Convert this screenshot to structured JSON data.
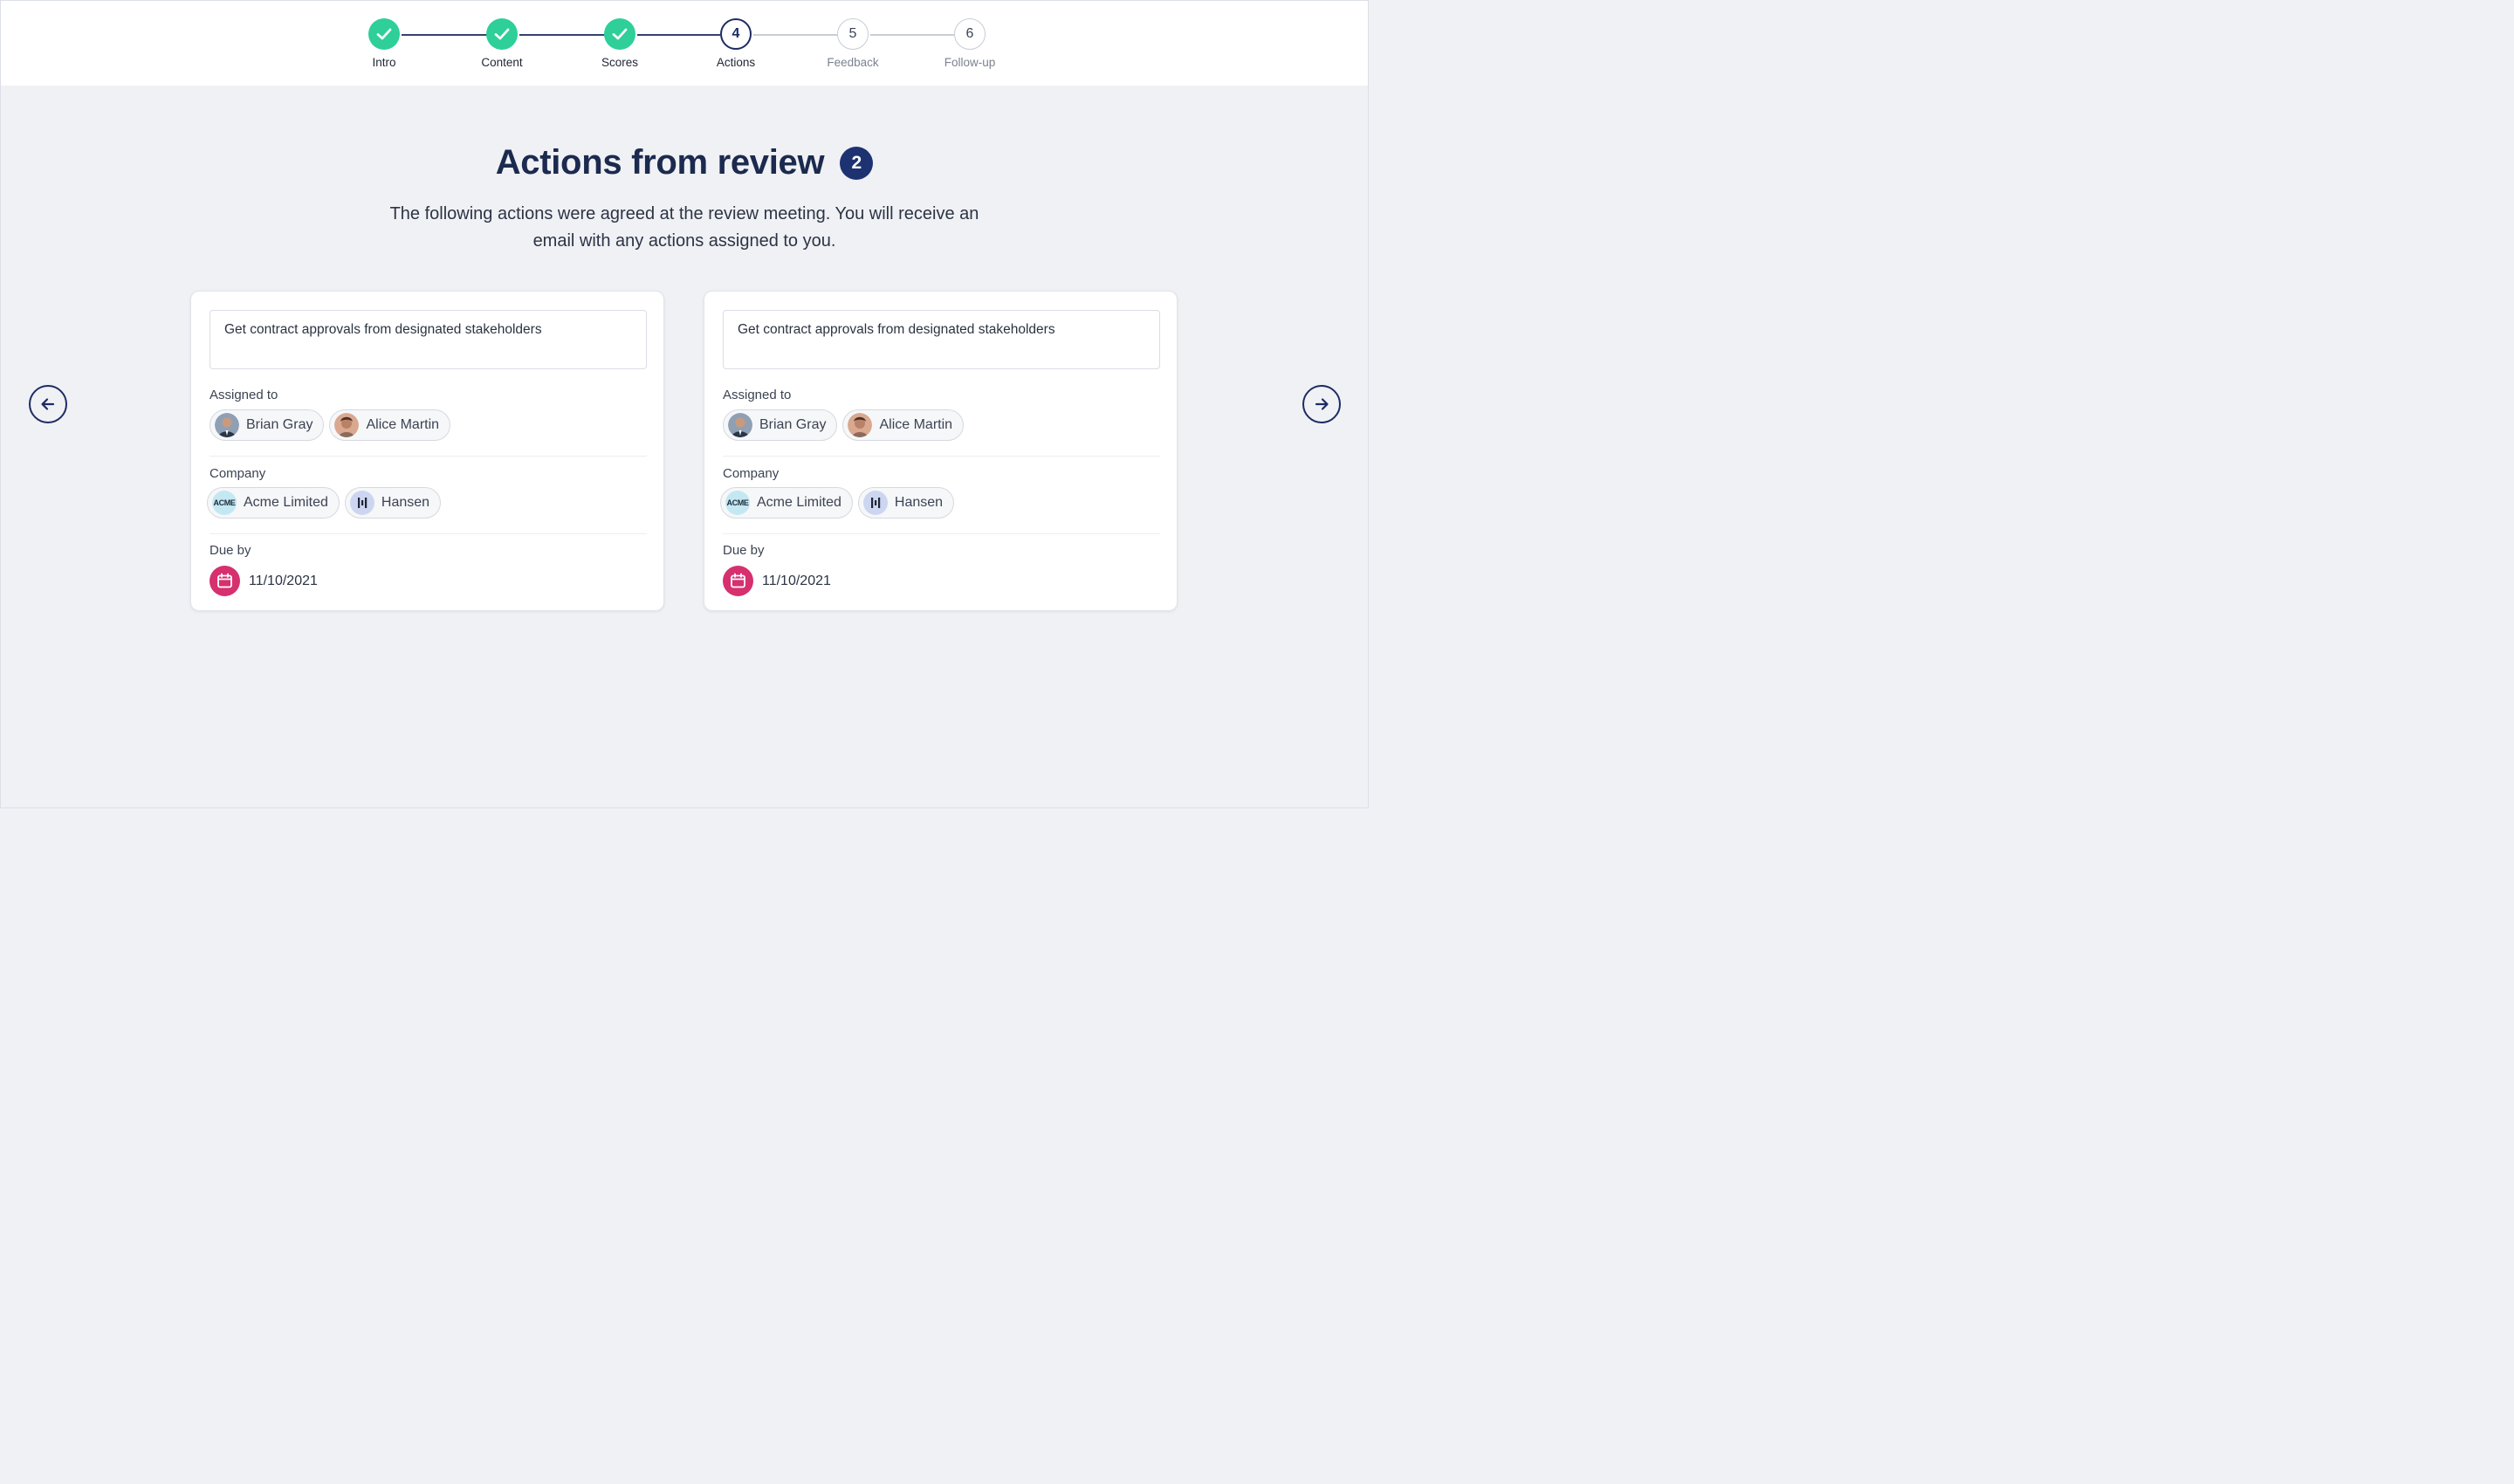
{
  "stepper": {
    "steps": [
      {
        "label": "Intro",
        "number": "1",
        "state": "done"
      },
      {
        "label": "Content",
        "number": "2",
        "state": "done"
      },
      {
        "label": "Scores",
        "number": "3",
        "state": "done"
      },
      {
        "label": "Actions",
        "number": "4",
        "state": "current"
      },
      {
        "label": "Feedback",
        "number": "5",
        "state": "todo"
      },
      {
        "label": "Follow-up",
        "number": "6",
        "state": "todo"
      }
    ]
  },
  "page": {
    "title": "Actions from review",
    "count_badge": "2",
    "subtitle": "The following actions were agreed at the review meeting. You will receive an email with any actions assigned to you."
  },
  "nav": {
    "prev_icon": "arrow-left-icon",
    "next_icon": "arrow-right-icon"
  },
  "cards": [
    {
      "action": "Get contract approvals from designated stakeholders",
      "assigned_label": "Assigned to",
      "assignees": [
        {
          "name": "Brian Gray",
          "avatar": "avatar-photo"
        },
        {
          "name": "Alice Martin",
          "avatar": "avatar-photo"
        }
      ],
      "company_label": "Company",
      "companies": [
        {
          "name": "Acme Limited",
          "logo_text": "ACME"
        },
        {
          "name": "Hansen",
          "logo_text": ""
        }
      ],
      "due_label": "Due by",
      "due_date": "11/10/2021"
    },
    {
      "action": "Get contract approvals from designated stakeholders",
      "assigned_label": "Assigned to",
      "assignees": [
        {
          "name": "Brian Gray",
          "avatar": "avatar-photo"
        },
        {
          "name": "Alice Martin",
          "avatar": "avatar-photo"
        }
      ],
      "company_label": "Company",
      "companies": [
        {
          "name": "Acme Limited",
          "logo_text": "ACME"
        },
        {
          "name": "Hansen",
          "logo_text": ""
        }
      ],
      "due_label": "Due by",
      "due_date": "11/10/2021"
    }
  ],
  "colors": {
    "done": "#2ecf98",
    "current": "#1d2b63",
    "badge": "#1d3270",
    "calendar": "#d6306e",
    "background": "#f0f1f5"
  }
}
